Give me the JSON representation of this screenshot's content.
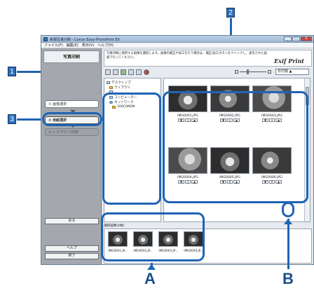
{
  "window": {
    "title": "新規写真印刷 - Canon Easy-PhotoPrint EX",
    "buttons": [
      "_",
      "□",
      "X"
    ]
  },
  "menu": [
    "ファイル(F)",
    "編集(E)",
    "表示(V)",
    "ヘルプ(H)"
  ],
  "left_panel": {
    "title": "写真印刷",
    "steps": [
      "① 画像選択",
      "② 用紙選択",
      "③ レイアウト/印刷"
    ],
    "back_button": "戻る",
    "help_button": "ヘルプ",
    "exit_button": "終了"
  },
  "instruction": "写真印刷に使用する画像を選択します。画像の補正や加工を行う場合は、補正/加工ボタンをクリックし、表示された画面で行ってください。",
  "logo": "Exif Print",
  "sort": "日付順 ▲",
  "tree": [
    "デスクトップ",
    "ライブラリ",
    "コンピューター",
    "ネットワーク",
    "100CANON"
  ],
  "thumbnails": [
    {
      "name": "IMG0001.JPG",
      "count": "1"
    },
    {
      "name": "IMG0002.JPG",
      "count": "1"
    },
    {
      "name": "IMG0003.JPG",
      "count": "1"
    },
    {
      "name": "IMG0004.JPG",
      "count": "1"
    },
    {
      "name": "IMG0005.JPG",
      "count": "0"
    },
    {
      "name": "IMG0006.JPG",
      "count": "0"
    }
  ],
  "selected_label": "選択画像(4枚)",
  "selected": [
    "IMG0001.JP...",
    "IMG0002.JP...",
    "IMG0003.JP...",
    "IMG0004.JP..."
  ],
  "callouts": {
    "one": "1",
    "two": "2",
    "three": "3",
    "a": "A",
    "b": "B"
  }
}
